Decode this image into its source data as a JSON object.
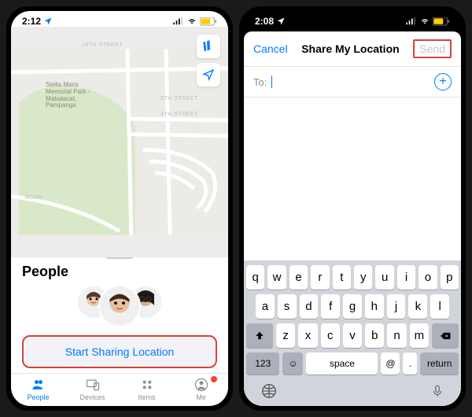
{
  "left": {
    "status": {
      "time": "2:12",
      "battery_color": "#ffcc00"
    },
    "map": {
      "park": "Stella Maris\nMemorial Park -\nMabalacat,\nPampanga",
      "streets": [
        "18TH STREET",
        "5TH STREET",
        "4TH STREET",
        "ROAD"
      ]
    },
    "sheet": {
      "title": "People",
      "start_sharing": "Start Sharing Location"
    },
    "tabs": [
      {
        "label": "People",
        "active": true
      },
      {
        "label": "Devices",
        "active": false
      },
      {
        "label": "Items",
        "active": false
      },
      {
        "label": "Me",
        "active": false,
        "badge": true
      }
    ]
  },
  "right": {
    "status": {
      "time": "2:08",
      "battery_color": "#ffcc00"
    },
    "modal": {
      "cancel": "Cancel",
      "title": "Share My Location",
      "send": "Send",
      "to_label": "To:",
      "to_value": ""
    },
    "keyboard": {
      "row1": [
        "q",
        "w",
        "e",
        "r",
        "t",
        "y",
        "u",
        "i",
        "o",
        "p"
      ],
      "row2": [
        "a",
        "s",
        "d",
        "f",
        "g",
        "h",
        "j",
        "k",
        "l"
      ],
      "row3": [
        "z",
        "x",
        "c",
        "v",
        "b",
        "n",
        "m"
      ],
      "numkey": "123",
      "space": "space",
      "at": "@",
      "dot": ".",
      "return": "return"
    }
  }
}
